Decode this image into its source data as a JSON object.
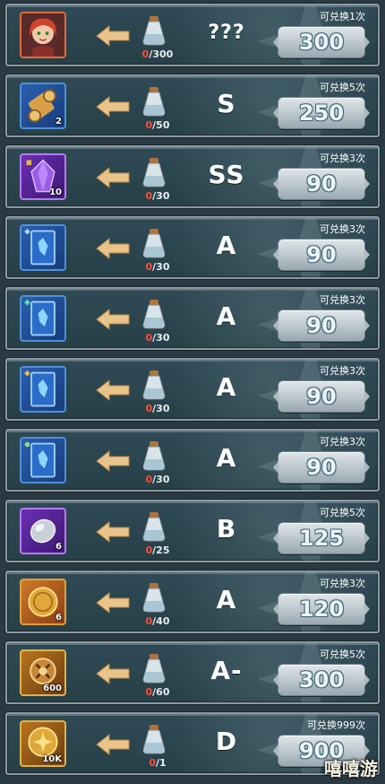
{
  "rows": [
    {
      "item_count": "",
      "item_style": "red",
      "item_icon": "hero-portrait-icon",
      "progress_cur": "0",
      "progress_total": "/300",
      "grade": "???",
      "limit": "可兑换1次",
      "price": "300"
    },
    {
      "item_count": "2",
      "item_style": "blue",
      "item_icon": "scroll-icon",
      "progress_cur": "0",
      "progress_total": "/50",
      "grade": "S",
      "limit": "可兑换5次",
      "price": "250"
    },
    {
      "item_count": "10",
      "item_style": "purple",
      "item_icon": "purple-crystal-icon",
      "progress_cur": "0",
      "progress_total": "/30",
      "grade": "SS",
      "limit": "可兑换3次",
      "price": "90"
    },
    {
      "item_count": "",
      "item_style": "blue",
      "item_icon": "blue-card-icon",
      "progress_cur": "0",
      "progress_total": "/30",
      "grade": "A",
      "limit": "可兑换3次",
      "price": "90"
    },
    {
      "item_count": "",
      "item_style": "blue",
      "item_icon": "blue-card-icon",
      "progress_cur": "0",
      "progress_total": "/30",
      "grade": "A",
      "limit": "可兑换3次",
      "price": "90"
    },
    {
      "item_count": "",
      "item_style": "blue",
      "item_icon": "blue-card-icon",
      "progress_cur": "0",
      "progress_total": "/30",
      "grade": "A",
      "limit": "可兑换3次",
      "price": "90"
    },
    {
      "item_count": "",
      "item_style": "blue",
      "item_icon": "blue-card-icon",
      "progress_cur": "0",
      "progress_total": "/30",
      "grade": "A",
      "limit": "可兑换3次",
      "price": "90"
    },
    {
      "item_count": "6",
      "item_style": "purple",
      "item_icon": "silver-stone-icon",
      "progress_cur": "0",
      "progress_total": "/25",
      "grade": "B",
      "limit": "可兑换5次",
      "price": "125"
    },
    {
      "item_count": "6",
      "item_style": "orange",
      "item_icon": "gold-coin-icon",
      "progress_cur": "0",
      "progress_total": "/40",
      "grade": "A",
      "limit": "可兑换3次",
      "price": "120"
    },
    {
      "item_count": "600",
      "item_style": "gold",
      "item_icon": "gold-medal-icon",
      "progress_cur": "0",
      "progress_total": "/60",
      "grade": "A-",
      "limit": "可兑换5次",
      "price": "300"
    },
    {
      "item_count": "10K",
      "item_style": "gold",
      "item_icon": "gold-coin-icon",
      "progress_cur": "0",
      "progress_total": "/1",
      "grade": "D",
      "limit": "可兑换999次",
      "price": "900"
    }
  ],
  "watermark": "嘻嘻游",
  "colors": {
    "progress_current": "#ff4c3b",
    "arrow": "#e8c48a",
    "panel": "#2f4a56"
  }
}
